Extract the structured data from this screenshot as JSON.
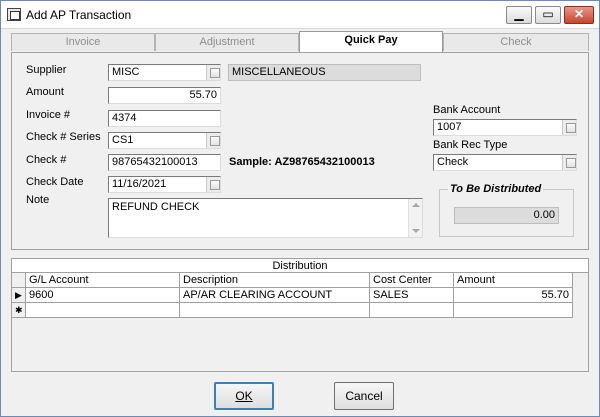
{
  "window": {
    "title": "Add AP Transaction"
  },
  "tabs": [
    "Invoice",
    "Adjustment",
    "Quick Pay",
    "Check"
  ],
  "form": {
    "supplier_label": "Supplier",
    "supplier_code": "MISC",
    "supplier_name": "MISCELLANEOUS",
    "amount_label": "Amount",
    "amount": "55.70",
    "invoice_label": "Invoice #",
    "invoice": "4374",
    "check_series_label": "Check # Series",
    "check_series": "CS1",
    "check_no_label": "Check  #",
    "check_no": "98765432100013",
    "sample_text": "Sample: AZ98765432100013",
    "check_date_label": "Check Date",
    "check_date": "11/16/2021",
    "note_label": "Note",
    "note": "REFUND CHECK",
    "bank_account_label": "Bank Account",
    "bank_account": "1007",
    "bank_rec_type_label": "Bank Rec Type",
    "bank_rec_type": "Check",
    "to_be_distributed_label": "To Be Distributed",
    "to_be_distributed": "0.00"
  },
  "distribution": {
    "title": "Distribution",
    "columns": [
      "G/L Account",
      "Description",
      "Cost Center",
      "Amount"
    ],
    "rows": [
      {
        "marker": "▶",
        "gl_account": "9600",
        "description": "AP/AR CLEARING ACCOUNT",
        "cost_center": "SALES",
        "amount": "55.70"
      },
      {
        "marker": "✱",
        "gl_account": "",
        "description": "",
        "cost_center": "",
        "amount": ""
      }
    ]
  },
  "buttons": {
    "ok": "OK",
    "cancel": "Cancel"
  }
}
